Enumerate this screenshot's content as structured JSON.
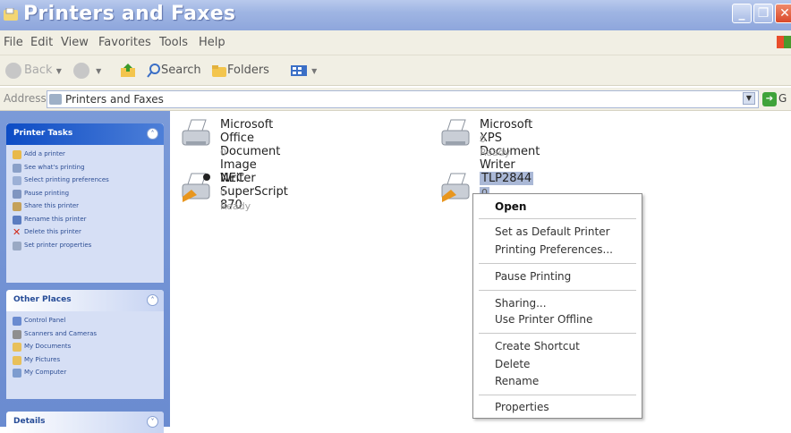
{
  "window": {
    "title": "Printers and Faxes"
  },
  "menu": [
    "File",
    "Edit",
    "View",
    "Favorites",
    "Tools",
    "Help"
  ],
  "toolbar": {
    "back": "Back",
    "search": "Search",
    "folders": "Folders"
  },
  "address": {
    "label": "Address",
    "value": "Printers and Faxes",
    "go": "G"
  },
  "left": {
    "tasks": {
      "title": "Printer Tasks",
      "items": [
        "Add a printer",
        "See what's printing",
        "Select printing preferences",
        "Pause printing",
        "Share this printer",
        "Rename this printer",
        "Delete this printer",
        "Set printer properties"
      ]
    },
    "places": {
      "title": "Other Places",
      "items": [
        "Control Panel",
        "Scanners and Cameras",
        "My Documents",
        "My Pictures",
        "My Computer"
      ]
    },
    "details": {
      "title": "Details"
    }
  },
  "printers": [
    {
      "name_line1": "Microsoft Office Document Image",
      "name_line2": "Writer",
      "docs": "0",
      "status": ""
    },
    {
      "name_line1": "Microsoft XPS Document Writer",
      "name_line2": "",
      "docs": "0",
      "status": "Ready"
    },
    {
      "name_line1": "NEC SuperScript 870",
      "name_line2": "",
      "docs": "0",
      "status": "Ready"
    },
    {
      "name_line1": "TLP2844",
      "name_line2": "",
      "docs": "0",
      "status": ""
    }
  ],
  "context_menu": {
    "open": "Open",
    "set_default": "Set as Default Printer",
    "preferences": "Printing Preferences...",
    "pause": "Pause Printing",
    "sharing": "Sharing...",
    "offline": "Use Printer Offline",
    "shortcut": "Create Shortcut",
    "delete": "Delete",
    "rename": "Rename",
    "properties": "Properties"
  }
}
